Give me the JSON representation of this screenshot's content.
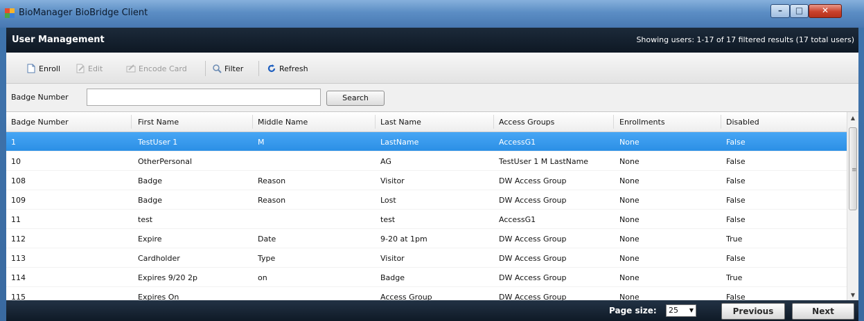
{
  "window": {
    "title": "BioManager BioBridge Client",
    "controls": {
      "minimize": "–",
      "maximize": "□",
      "close": "✕"
    }
  },
  "header": {
    "title": "User Management",
    "info": "Showing users: 1-17 of 17 filtered results (17 total users)"
  },
  "toolbar": {
    "enroll": "Enroll",
    "edit": "Edit",
    "encode_card": "Encode Card",
    "filter": "Filter",
    "refresh": "Refresh"
  },
  "search": {
    "label": "Badge Number",
    "value": "",
    "button": "Search"
  },
  "grid": {
    "columns": [
      "Badge Number",
      "First Name",
      "Middle Name",
      "Last Name",
      "Access Groups",
      "Enrollments",
      "Disabled"
    ],
    "rows": [
      [
        "1",
        "TestUser 1",
        "M",
        "LastName",
        "AccessG1",
        "None",
        "False"
      ],
      [
        "10",
        "OtherPersonal",
        "",
        "AG",
        "TestUser 1 M LastName",
        "None",
        "False"
      ],
      [
        "108",
        "Badge",
        "Reason",
        "Visitor",
        "DW Access Group",
        "None",
        "False"
      ],
      [
        "109",
        "Badge",
        "Reason",
        "Lost",
        "DW Access Group",
        "None",
        "False"
      ],
      [
        "11",
        "test",
        "",
        "test",
        "AccessG1",
        "None",
        "False"
      ],
      [
        "112",
        "Expire",
        "Date",
        "9-20 at 1pm",
        "DW Access Group",
        "None",
        "True"
      ],
      [
        "113",
        "Cardholder",
        "Type",
        "Visitor",
        "DW Access Group",
        "None",
        "False"
      ],
      [
        "114",
        "Expires 9/20 2p",
        "on",
        "Badge",
        "DW Access Group",
        "None",
        "True"
      ],
      [
        "115",
        "Expires On",
        "",
        "Access Group",
        "DW Access Group",
        "None",
        "False"
      ]
    ]
  },
  "pager": {
    "page_size_label": "Page size:",
    "page_size": "25",
    "previous": "Previous",
    "next": "Next"
  },
  "colors": {
    "selected_row": "#2b8fe5",
    "header_bg": "#0e1824",
    "title_bar": "#5b8dc4"
  }
}
